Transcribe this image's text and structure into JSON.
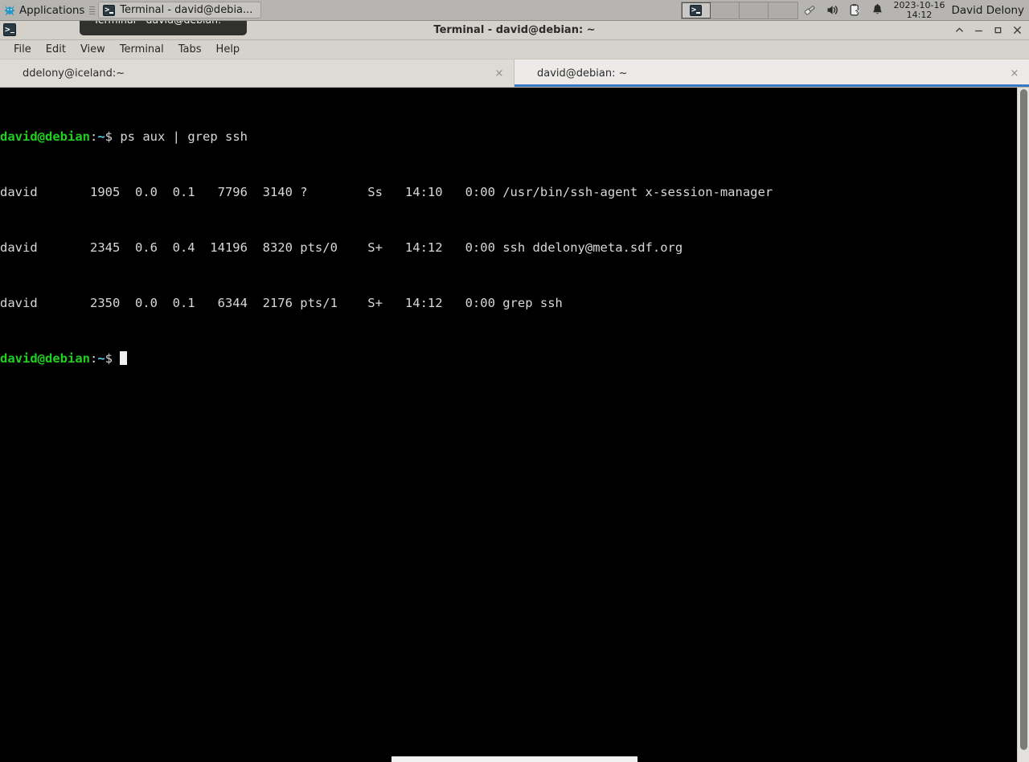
{
  "panel": {
    "applications_label": "Applications",
    "applications_icon": "xfce-mouse-icon",
    "task_button": {
      "label": "Terminal - david@debia...",
      "icon": "terminal-icon"
    },
    "workspaces": [
      {
        "name": "workspace-1",
        "active": true,
        "icon": "terminal-icon"
      },
      {
        "name": "workspace-2",
        "active": false,
        "icon": ""
      },
      {
        "name": "workspace-3",
        "active": false,
        "icon": ""
      },
      {
        "name": "workspace-4",
        "active": false,
        "icon": ""
      }
    ],
    "tray": [
      {
        "name": "usb-drive-icon"
      },
      {
        "name": "volume-speaker-icon"
      },
      {
        "name": "battery-charging-icon"
      },
      {
        "name": "notification-bell-icon"
      }
    ],
    "clock": {
      "date": "2023-10-16",
      "time": "14:12"
    },
    "username": "David Delony"
  },
  "window": {
    "title": "Terminal - david@debian: ~",
    "icon": "terminal-icon",
    "controls": {
      "shade": "˄",
      "minimize": "—",
      "maximize": "□",
      "close": "✕"
    }
  },
  "menu": {
    "items": [
      "File",
      "Edit",
      "View",
      "Terminal",
      "Tabs",
      "Help"
    ]
  },
  "tooltip": {
    "text": "Terminal - david@debian: ~"
  },
  "tabs": [
    {
      "label": "ddelony@iceland:~",
      "close": "×",
      "active": false
    },
    {
      "label": "david@debian: ~",
      "close": "×",
      "active": true
    }
  ],
  "terminal": {
    "prompt": {
      "user_host": "david@debian",
      "colon": ":",
      "path": "~",
      "sigil": "$"
    },
    "command": " ps aux | grep ssh",
    "output": [
      "david       1905  0.0  0.1   7796  3140 ?        Ss   14:10   0:00 /usr/bin/ssh-agent x-session-manager",
      "david       2345  0.6  0.4  14196  8320 pts/0    S+   14:12   0:00 ssh ddelony@meta.sdf.org",
      "david       2350  0.0  0.1   6344  2176 pts/1    S+   14:12   0:00 grep ssh"
    ],
    "colors": {
      "background": "#000000",
      "foreground": "#d0d0d0",
      "prompt_user": "#20d020",
      "prompt_path": "#4fd2e6",
      "cursor": "#f0f0f0"
    }
  },
  "scrollbar": {
    "name": "terminal-scrollbar"
  }
}
